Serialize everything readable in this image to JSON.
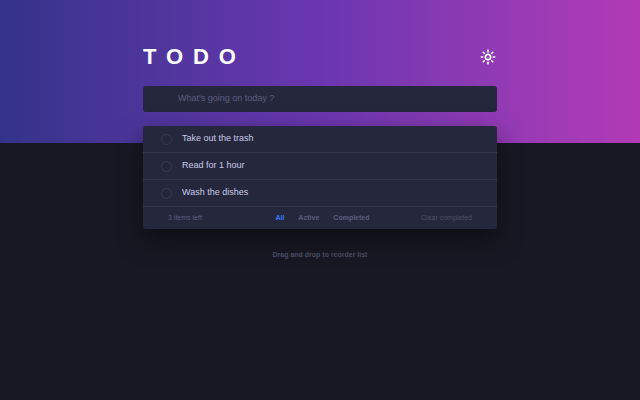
{
  "header": {
    "title": "TODO"
  },
  "new_todo": {
    "placeholder": "What's going on today ?"
  },
  "todos": [
    {
      "text": "Take out the trash",
      "completed": false
    },
    {
      "text": "Read for 1 hour",
      "completed": false
    },
    {
      "text": "Wash the dishes",
      "completed": false
    }
  ],
  "footer": {
    "items_left": "3 items left",
    "filters": [
      {
        "label": "All",
        "selected": true
      },
      {
        "label": "Active",
        "selected": false
      },
      {
        "label": "Completed",
        "selected": false
      }
    ],
    "clear": "Clear completed"
  },
  "hint": "Drag and drop to reorder list"
}
